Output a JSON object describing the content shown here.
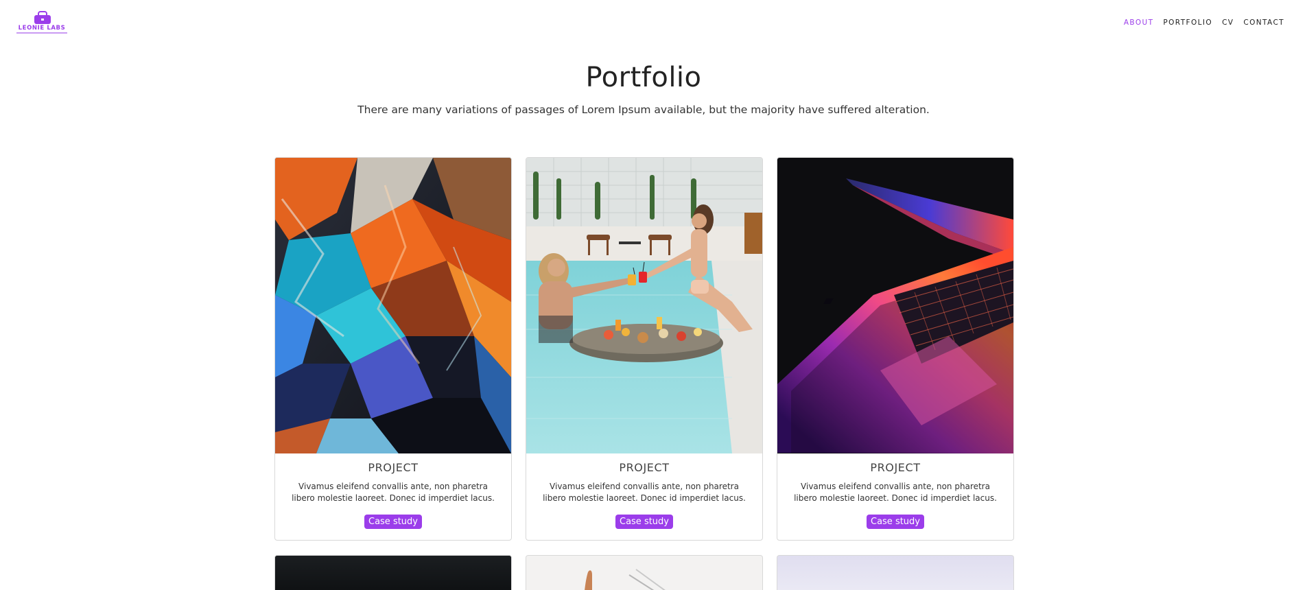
{
  "brand": {
    "logo_text": "LEONIE LABS",
    "accent": "#9b3dea"
  },
  "nav": {
    "items": [
      "ABOUT",
      "PORTFOLIO",
      "CV",
      "CONTACT"
    ],
    "active": "ABOUT"
  },
  "hero": {
    "title": "Portfolio",
    "subtitle": "There are many variations of passages of Lorem Ipsum available, but the majority have suffered alteration."
  },
  "cards": [
    {
      "image": "holographic-foil-photo",
      "title": "PROJECT",
      "description": "Vivamus eleifend convallis ante, non pharetra libero molestie laoreet. Donec id imperdiet lacus.",
      "button": "Case study"
    },
    {
      "image": "pool-couple-photo",
      "title": "PROJECT",
      "description": "Vivamus eleifend convallis ante, non pharetra libero molestie laoreet. Donec id imperdiet lacus.",
      "button": "Case study"
    },
    {
      "image": "laptop-neon-photo",
      "title": "PROJECT",
      "description": "Vivamus eleifend convallis ante, non pharetra libero molestie laoreet. Donec id imperdiet lacus.",
      "button": "Case study"
    }
  ],
  "second_row_images": [
    "dark-photo",
    "sketch-photo",
    "lavender-photo"
  ]
}
